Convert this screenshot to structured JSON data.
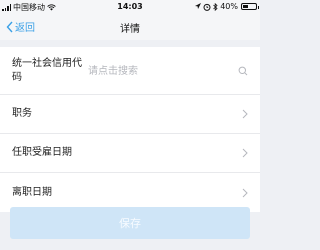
{
  "status_bar": {
    "carrier": "中国移动",
    "time": "14:03",
    "battery": "40%",
    "battery_level": 0.4
  },
  "nav": {
    "back_label": "返回",
    "title": "详情"
  },
  "form": {
    "credit_code": {
      "label": "统一社会信用代码",
      "placeholder": "请点击搜索"
    },
    "position": {
      "label": "职务"
    },
    "hire_date": {
      "label": "任职受雇日期"
    },
    "leave_date": {
      "label": "离职日期"
    }
  },
  "actions": {
    "save_label": "保存"
  },
  "icons": {
    "back": "chevron-left-icon",
    "search": "search-icon",
    "chevron": "chevron-right-icon"
  },
  "colors": {
    "accent": "#3aa0e6",
    "button_disabled": "#cfe5f7"
  }
}
